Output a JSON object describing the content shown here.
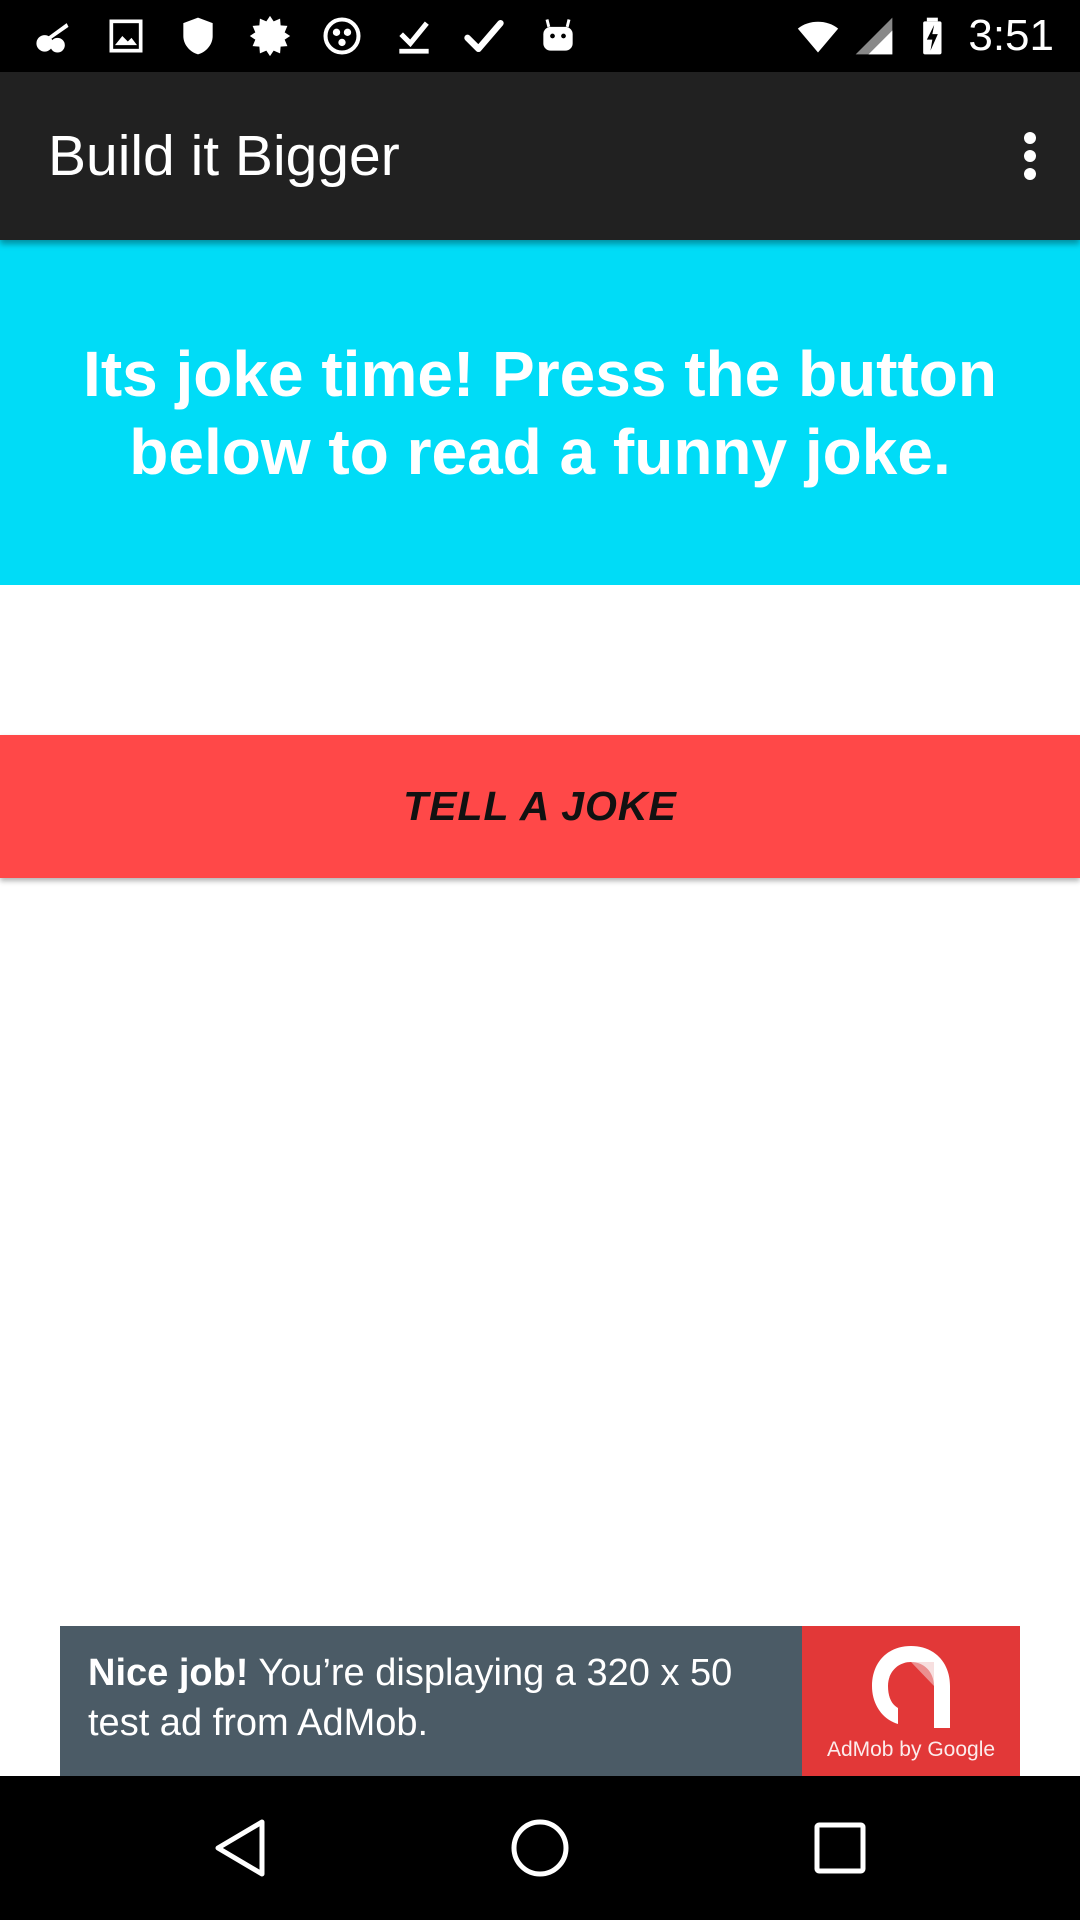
{
  "status_bar": {
    "time": "3:51",
    "notification_icons": [
      "music-notification-icon",
      "image-notification-icon",
      "shield-notification-icon",
      "settings-burst-icon",
      "app-notification-icon",
      "download-done-icon",
      "check-icon",
      "android-robot-icon"
    ],
    "system_icons": [
      "wifi-icon",
      "cell-signal-icon",
      "battery-charging-icon"
    ]
  },
  "app_bar": {
    "title": "Build it Bigger",
    "menu_icon": "more-vert-icon"
  },
  "banner": {
    "text": "Its joke time! Press the button below to read a funny joke.",
    "background_color": "#00dcf7"
  },
  "joke_button": {
    "label": "TELL A JOKE",
    "background_color": "#ff4848"
  },
  "ad": {
    "headline": "Nice job!",
    "body": " You’re displaying a 320 x 50 test ad from AdMob.",
    "logo_text": "AdMob by Google"
  },
  "nav_bar": {
    "buttons": [
      "back-icon",
      "home-icon",
      "recents-icon"
    ]
  },
  "colors": {
    "app_bar": "#212121",
    "status_bar": "#000000",
    "ad_background": "#4b5b66",
    "ad_logo_background": "#e23838"
  }
}
